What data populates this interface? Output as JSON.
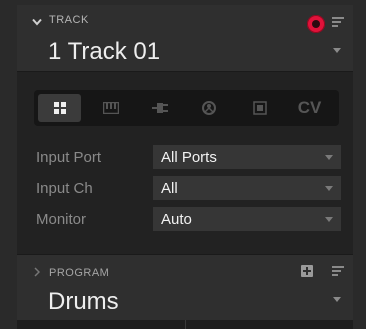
{
  "track": {
    "section_label": "TRACK",
    "name": "1 Track 01",
    "record_color": "#e0123a"
  },
  "mode_tabs": [
    {
      "icon": "grid-icon",
      "active": true
    },
    {
      "icon": "keyboard-icon",
      "active": false
    },
    {
      "icon": "plug-icon",
      "active": false
    },
    {
      "icon": "hardware-icon",
      "active": false
    },
    {
      "icon": "box-icon",
      "active": false
    },
    {
      "label": "CV",
      "active": false
    }
  ],
  "rows": {
    "input_port": {
      "label": "Input Port",
      "value": "All Ports"
    },
    "input_ch": {
      "label": "Input Ch",
      "value": "All"
    },
    "monitor": {
      "label": "Monitor",
      "value": "Auto"
    }
  },
  "program": {
    "section_label": "PROGRAM",
    "name": "Drums"
  }
}
